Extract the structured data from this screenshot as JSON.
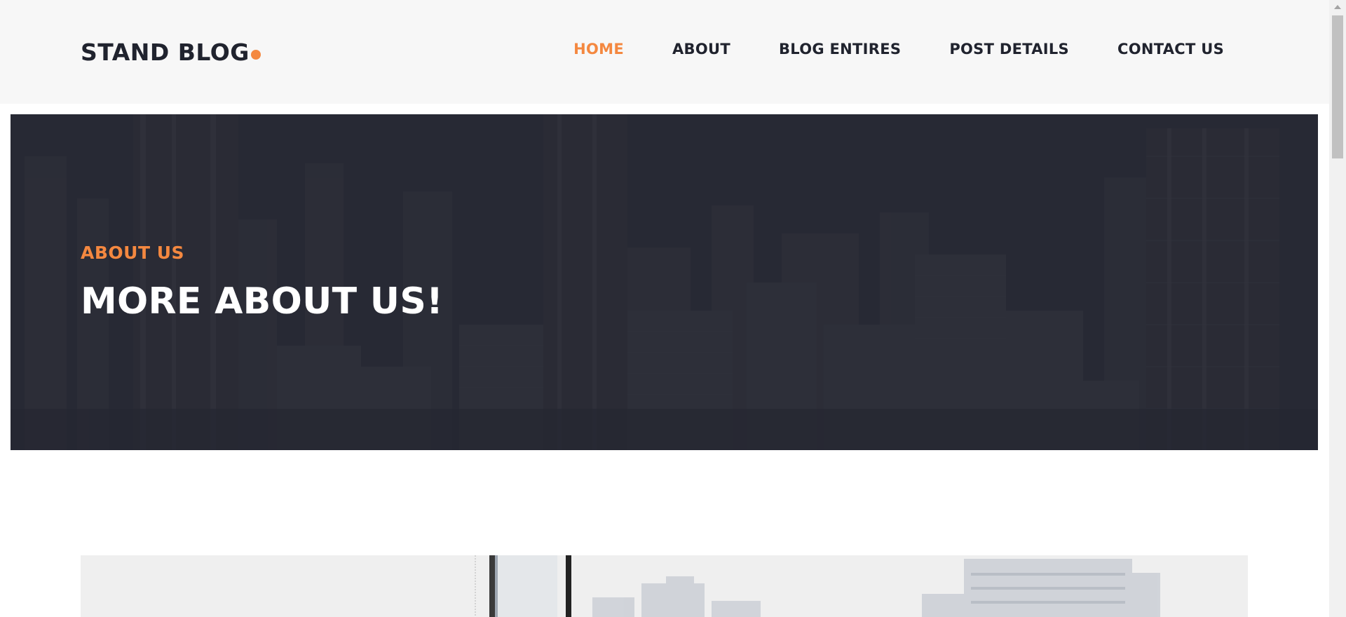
{
  "header": {
    "logo_text": "STAND BLOG",
    "logo_dot_color": "#f48840",
    "nav": [
      {
        "label": "HOME",
        "active": true
      },
      {
        "label": "ABOUT",
        "active": false
      },
      {
        "label": "BLOG ENTIRES",
        "active": false
      },
      {
        "label": "POST DETAILS",
        "active": false
      },
      {
        "label": "CONTACT US",
        "active": false
      }
    ]
  },
  "hero": {
    "subtitle": "ABOUT US",
    "title": "MORE ABOUT US!"
  },
  "colors": {
    "accent": "#f48840",
    "dark": "#20232e",
    "header_bg": "#f7f7f7"
  }
}
